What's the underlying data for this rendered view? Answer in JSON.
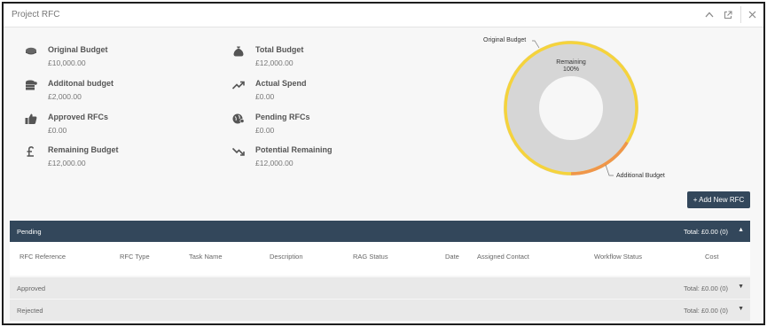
{
  "window": {
    "title": "Project RFC"
  },
  "stats": [
    {
      "label": "Original Budget",
      "value": "£10,000.00",
      "icon": "coin-icon"
    },
    {
      "label": "Total Budget",
      "value": "£12,000.00",
      "icon": "money-bag-icon"
    },
    {
      "label": "Additonal budget",
      "value": "£2,000.00",
      "icon": "coin-stack-icon"
    },
    {
      "label": "Actual Spend",
      "value": "£0.00",
      "icon": "trend-up-icon"
    },
    {
      "label": "Approved RFCs",
      "value": "£0.00",
      "icon": "thumbs-up-icon"
    },
    {
      "label": "Pending RFCs",
      "value": "£0.00",
      "icon": "globe-money-icon"
    },
    {
      "label": "Remaining Budget",
      "value": "£12,000.00",
      "icon": "pound-icon"
    },
    {
      "label": "Potential Remaining",
      "value": "£12,000.00",
      "icon": "trend-down-icon"
    }
  ],
  "donut": {
    "center_label": "Remaining",
    "center_value": "100%",
    "outer_labels": [
      "Original Budget",
      "Additional Budget"
    ],
    "colors": {
      "remaining": "#d6d6d6",
      "original": "#f5d33c",
      "additional": "#f0964a"
    }
  },
  "add_button": "+ Add New RFC",
  "pending": {
    "label": "Pending",
    "total": "Total: £0.00 (0)"
  },
  "columns": [
    "RFC Reference",
    "RFC Type",
    "Task Name",
    "Description",
    "RAG Status",
    "Date",
    "Assigned Contact",
    "Workflow Status",
    "Cost"
  ],
  "groups": [
    {
      "label": "Approved",
      "total": "Total: £0.00 (0)"
    },
    {
      "label": "Rejected",
      "total": "Total: £0.00 (0)"
    }
  ],
  "colors": {
    "header_bar": "#33475b",
    "group_bar": "#e9e9e9"
  }
}
